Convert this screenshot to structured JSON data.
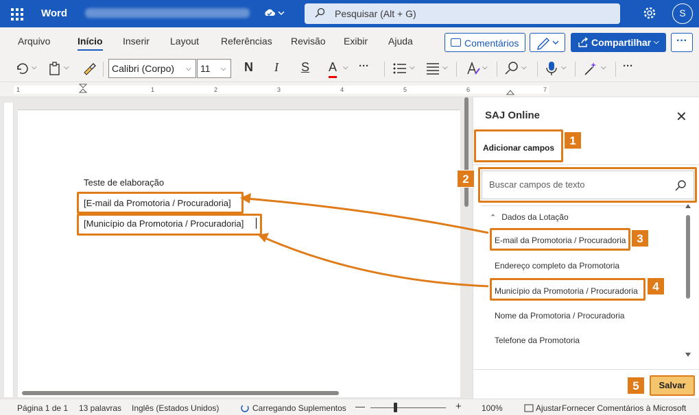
{
  "app": {
    "name": "Word",
    "doc_title": "███████ ███ ███ ███████ ██████",
    "search_placeholder": "Pesquisar (Alt + G)",
    "avatar_initial": "S"
  },
  "ribbon": {
    "tabs": [
      "Arquivo",
      "Início",
      "Inserir",
      "Layout",
      "Referências",
      "Revisão",
      "Exibir",
      "Ajuda"
    ],
    "active_tab": "Início",
    "comments_label": "Comentários",
    "share_label": "Compartilhar",
    "more_label": "···"
  },
  "toolbar": {
    "font_name": "Calibri (Corpo)",
    "font_size": "11",
    "bold": "N",
    "italic": "I",
    "strike": "S",
    "font_color_letter": "A",
    "more": "···"
  },
  "ruler": {
    "numbers": [
      "1",
      "1",
      "2",
      "3",
      "4",
      "5",
      "6",
      "7"
    ]
  },
  "document": {
    "heading": "Teste de elaboração",
    "field_email": "[E-mail da Promotoria / Procuradoria]",
    "field_municipio": "[Município da Promotoria / Procuradoria]"
  },
  "panel": {
    "title": "SAJ Online",
    "tab_label": "Adicionar campos",
    "search_placeholder": "Buscar campos de texto",
    "group_label": "Dados da Lotação",
    "items": [
      "E-mail da Promotoria / Procuradoria",
      "Endereço completo da Promotoria",
      "Município da Promotoria / Procuradoria",
      "Nome da Promotoria / Procuradoria",
      "Telefone da Promotoria"
    ],
    "save_label": "Salvar"
  },
  "callouts": [
    "1",
    "2",
    "3",
    "4",
    "5"
  ],
  "statusbar": {
    "page": "Página 1 de 1",
    "words": "13 palavras",
    "language": "Inglês (Estados Unidos)",
    "addins": "Carregando Suplementos",
    "zoom": "100%",
    "fit": "Ajustar",
    "feedback": "Fornecer Comentários à Microsoft"
  },
  "colors": {
    "brand": "#185abd",
    "callout": "#e07b1a",
    "save_bg": "#f4c56d"
  }
}
